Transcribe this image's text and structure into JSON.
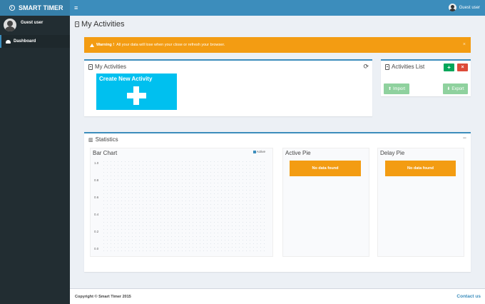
{
  "header": {
    "brand": "SMART TIMER",
    "menu_icon": "hamburger-icon",
    "user_label": "Guest user",
    "accent": "#3c8dbc"
  },
  "sidebar": {
    "user_name": "Guest user",
    "items": [
      {
        "label": "Dashboard",
        "icon": "dashboard-icon",
        "active": true
      }
    ]
  },
  "page": {
    "title": "My Activities"
  },
  "alert": {
    "strong": "Warning !",
    "message": "All your data will lose when your close or refresh your browser.",
    "close": "×",
    "color": "#f39c12"
  },
  "my_activities": {
    "title": "My Activities",
    "create_label": "Create New Activity",
    "tile_color": "#00c0ef"
  },
  "activities_list": {
    "title": "Activities List",
    "add": "+",
    "remove": "×",
    "import_label": "Import",
    "export_label": "Export"
  },
  "statistics": {
    "title": "Statistics",
    "collapse": "−",
    "bar_chart": {
      "title": "Bar Chart",
      "legend": "Active",
      "yticks": [
        "1.0",
        "0.8",
        "0.6",
        "0.4",
        "0.2",
        "0.0"
      ]
    },
    "active_pie": {
      "title": "Active Pie",
      "empty": "No data found"
    },
    "delay_pie": {
      "title": "Delay Pie",
      "empty": "No data found"
    }
  },
  "chart_data": {
    "type": "bar",
    "categories": [],
    "series": [
      {
        "name": "Active",
        "values": []
      }
    ],
    "title": "Bar Chart",
    "ylim": [
      0,
      1.0
    ],
    "yticks": [
      0.0,
      0.2,
      0.4,
      0.6,
      0.8,
      1.0
    ],
    "legend": "top-right"
  },
  "footer": {
    "copyright": "Copyright © Smart Timer 2015",
    "contact": "Contact us"
  }
}
